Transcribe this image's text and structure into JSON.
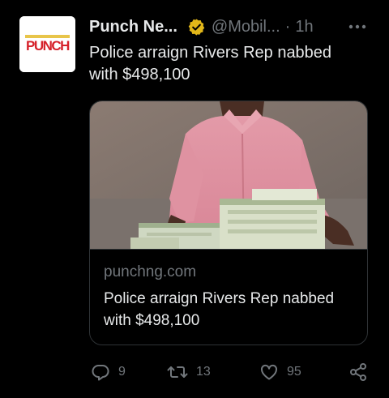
{
  "tweet": {
    "author_name": "Punch Ne...",
    "handle": "@Mobil...",
    "separator": "·",
    "time": "1h",
    "text": "Police arraign Rivers Rep nabbed with $498,100",
    "avatar_logo_text": "PUNCH",
    "verified_color": "#e2b719",
    "accent_red": "#d6212a"
  },
  "card": {
    "domain": "punchng.com",
    "title": "Police arraign Rivers Rep nabbed with $498,100"
  },
  "actions": {
    "replies": "9",
    "reposts": "13",
    "likes": "95"
  },
  "icons": {
    "more": "more-icon",
    "reply": "reply-icon",
    "repost": "repost-icon",
    "like": "like-icon",
    "share": "share-icon",
    "verified": "verified-badge-icon"
  }
}
